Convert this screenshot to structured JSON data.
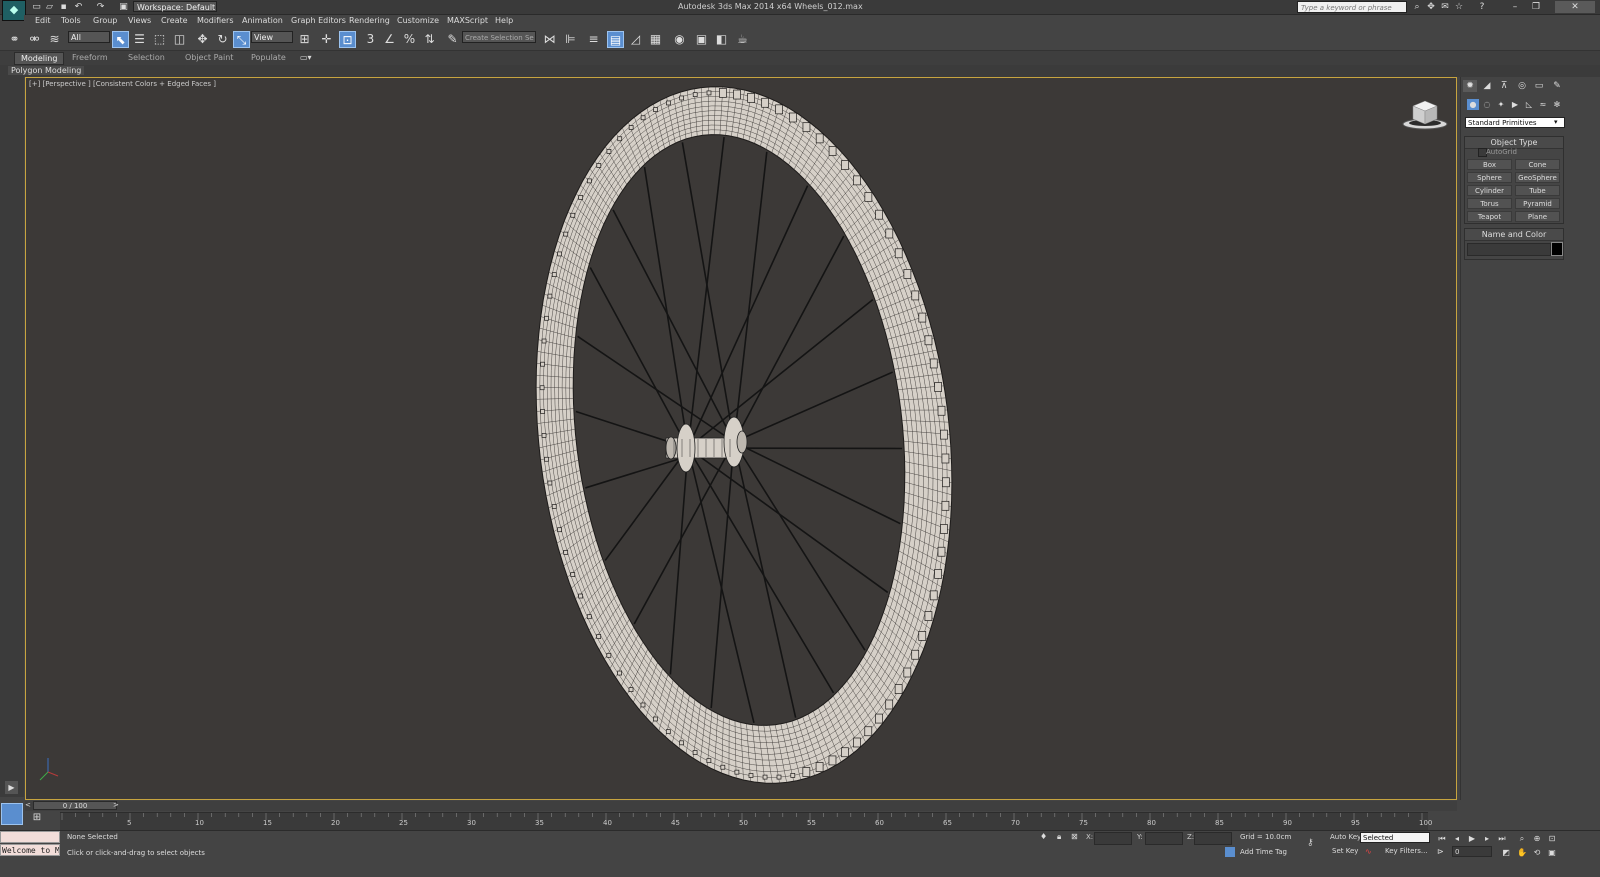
{
  "titlebar": {
    "workspace": "Workspace: Default",
    "title": "Autodesk 3ds Max  2014 x64      Wheels_012.max",
    "search_placeholder": "Type a keyword or phrase"
  },
  "menu": [
    "Edit",
    "Tools",
    "Group",
    "Views",
    "Create",
    "Modifiers",
    "Animation",
    "Graph Editors",
    "Rendering",
    "Customize",
    "MAXScript",
    "Help"
  ],
  "toolbar": {
    "filter": "All",
    "ref_coord": "View",
    "selection_set": "Create Selection Se"
  },
  "ribbon": {
    "tabs": [
      "Modeling",
      "Freeform",
      "Selection",
      "Object Paint",
      "Populate"
    ],
    "active_tab": "Modeling",
    "panel_label": "Polygon Modeling"
  },
  "viewport": {
    "label": "[+] [Perspective ] [Consistent Colors + Edged Faces ]",
    "colors": {
      "background": "#3c3937",
      "frame": "#c7a43f",
      "mesh": "#d6d0c8",
      "wire": "#3b3835",
      "spoke": "#141414"
    }
  },
  "command_panel": {
    "category": "Standard Primitives",
    "object_type_title": "Object Type",
    "autogrid": "AutoGrid",
    "primitives": [
      [
        "Box",
        "Cone"
      ],
      [
        "Sphere",
        "GeoSphere"
      ],
      [
        "Cylinder",
        "Tube"
      ],
      [
        "Torus",
        "Pyramid"
      ],
      [
        "Teapot",
        "Plane"
      ]
    ],
    "name_color_title": "Name and Color"
  },
  "timeline": {
    "slider": "0 / 100",
    "ticks": [
      "5",
      "10",
      "15",
      "20",
      "25",
      "30",
      "35",
      "40",
      "45",
      "50",
      "55",
      "60",
      "65",
      "70",
      "75",
      "80",
      "85",
      "90",
      "95",
      "100"
    ]
  },
  "status": {
    "listener": "Welcome to M",
    "selection": "None Selected",
    "prompt": "Click or click-and-drag to select objects",
    "x_label": "X:",
    "y_label": "Y:",
    "z_label": "Z:",
    "grid": "Grid = 10.0cm",
    "add_time_tag": "Add Time Tag",
    "auto_key": "Auto Key",
    "auto_key_mode": "Selected",
    "set_key": "Set Key",
    "key_filters": "Key Filters...",
    "frame": "0"
  }
}
